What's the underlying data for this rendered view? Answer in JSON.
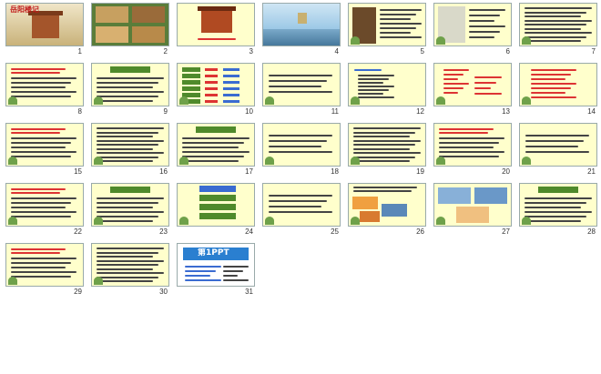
{
  "slides": [
    {
      "n": "1",
      "bg": "#e8d9b0",
      "title": "岳阳楼记",
      "variant": "cover"
    },
    {
      "n": "2",
      "bg": "#5a7d3a",
      "variant": "photos"
    },
    {
      "n": "3",
      "bg": "#ffffcc",
      "variant": "tower"
    },
    {
      "n": "4",
      "bg": "#e7edf2",
      "variant": "lake"
    },
    {
      "n": "5",
      "bg": "#ffffcc",
      "variant": "portrait"
    },
    {
      "n": "6",
      "bg": "#ffffcc",
      "variant": "sketch"
    },
    {
      "n": "7",
      "bg": "#ffffcc",
      "variant": "text-dense"
    },
    {
      "n": "8",
      "bg": "#ffffcc",
      "variant": "text-red"
    },
    {
      "n": "9",
      "bg": "#ffffcc",
      "variant": "text-green-head"
    },
    {
      "n": "10",
      "bg": "#ffffcc",
      "variant": "vocab"
    },
    {
      "n": "11",
      "bg": "#ffffcc",
      "variant": "text-plain"
    },
    {
      "n": "12",
      "bg": "#ffffcc",
      "variant": "list-blue"
    },
    {
      "n": "13",
      "bg": "#ffffcc",
      "variant": "list-red"
    },
    {
      "n": "14",
      "bg": "#ffffcc",
      "variant": "list-red2"
    },
    {
      "n": "15",
      "bg": "#ffffcc",
      "variant": "text-red"
    },
    {
      "n": "16",
      "bg": "#ffffcc",
      "variant": "text-dense"
    },
    {
      "n": "17",
      "bg": "#ffffcc",
      "variant": "text-green-head"
    },
    {
      "n": "18",
      "bg": "#ffffcc",
      "variant": "text-plain"
    },
    {
      "n": "19",
      "bg": "#ffffcc",
      "variant": "text-dense"
    },
    {
      "n": "20",
      "bg": "#ffffcc",
      "variant": "text-red"
    },
    {
      "n": "21",
      "bg": "#ffffcc",
      "variant": "text-plain"
    },
    {
      "n": "22",
      "bg": "#ffffcc",
      "variant": "text-red"
    },
    {
      "n": "23",
      "bg": "#ffffcc",
      "variant": "text-green-head"
    },
    {
      "n": "24",
      "bg": "#ffffcc",
      "variant": "flow"
    },
    {
      "n": "25",
      "bg": "#ffffcc",
      "variant": "text-plain"
    },
    {
      "n": "26",
      "bg": "#ffffcc",
      "variant": "photos2"
    },
    {
      "n": "27",
      "bg": "#ffffcc",
      "variant": "photos3"
    },
    {
      "n": "28",
      "bg": "#ffffcc",
      "variant": "text-green-head"
    },
    {
      "n": "29",
      "bg": "#ffffcc",
      "variant": "text-red"
    },
    {
      "n": "30",
      "bg": "#ffffcc",
      "variant": "text-dense"
    },
    {
      "n": "31",
      "bg": "#ffffff",
      "title": "第1PPT",
      "variant": "brand"
    }
  ]
}
